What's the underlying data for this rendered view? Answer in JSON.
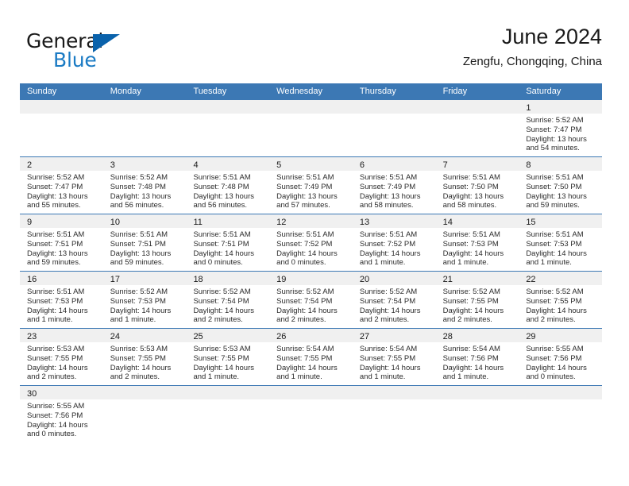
{
  "brand": {
    "name_top": "General",
    "name_bottom": "Blue",
    "accent_color": "#0a62ab",
    "blue_text_color": "#1b7bc4",
    "triangle_icon": "triangle-icon"
  },
  "header": {
    "title": "June 2024",
    "subtitle": "Zengfu, Chongqing, China"
  },
  "calendar": {
    "header_bg": "#3c78b4",
    "row_divider_color": "#3c78b4",
    "day_band_bg": "#f0f0f0",
    "weekdays": [
      "Sunday",
      "Monday",
      "Tuesday",
      "Wednesday",
      "Thursday",
      "Friday",
      "Saturday"
    ],
    "weeks": [
      [
        {
          "day": "",
          "lines": []
        },
        {
          "day": "",
          "lines": []
        },
        {
          "day": "",
          "lines": []
        },
        {
          "day": "",
          "lines": []
        },
        {
          "day": "",
          "lines": []
        },
        {
          "day": "",
          "lines": []
        },
        {
          "day": "1",
          "lines": [
            "Sunrise: 5:52 AM",
            "Sunset: 7:47 PM",
            "Daylight: 13 hours",
            "and 54 minutes."
          ]
        }
      ],
      [
        {
          "day": "2",
          "lines": [
            "Sunrise: 5:52 AM",
            "Sunset: 7:47 PM",
            "Daylight: 13 hours",
            "and 55 minutes."
          ]
        },
        {
          "day": "3",
          "lines": [
            "Sunrise: 5:52 AM",
            "Sunset: 7:48 PM",
            "Daylight: 13 hours",
            "and 56 minutes."
          ]
        },
        {
          "day": "4",
          "lines": [
            "Sunrise: 5:51 AM",
            "Sunset: 7:48 PM",
            "Daylight: 13 hours",
            "and 56 minutes."
          ]
        },
        {
          "day": "5",
          "lines": [
            "Sunrise: 5:51 AM",
            "Sunset: 7:49 PM",
            "Daylight: 13 hours",
            "and 57 minutes."
          ]
        },
        {
          "day": "6",
          "lines": [
            "Sunrise: 5:51 AM",
            "Sunset: 7:49 PM",
            "Daylight: 13 hours",
            "and 58 minutes."
          ]
        },
        {
          "day": "7",
          "lines": [
            "Sunrise: 5:51 AM",
            "Sunset: 7:50 PM",
            "Daylight: 13 hours",
            "and 58 minutes."
          ]
        },
        {
          "day": "8",
          "lines": [
            "Sunrise: 5:51 AM",
            "Sunset: 7:50 PM",
            "Daylight: 13 hours",
            "and 59 minutes."
          ]
        }
      ],
      [
        {
          "day": "9",
          "lines": [
            "Sunrise: 5:51 AM",
            "Sunset: 7:51 PM",
            "Daylight: 13 hours",
            "and 59 minutes."
          ]
        },
        {
          "day": "10",
          "lines": [
            "Sunrise: 5:51 AM",
            "Sunset: 7:51 PM",
            "Daylight: 13 hours",
            "and 59 minutes."
          ]
        },
        {
          "day": "11",
          "lines": [
            "Sunrise: 5:51 AM",
            "Sunset: 7:51 PM",
            "Daylight: 14 hours",
            "and 0 minutes."
          ]
        },
        {
          "day": "12",
          "lines": [
            "Sunrise: 5:51 AM",
            "Sunset: 7:52 PM",
            "Daylight: 14 hours",
            "and 0 minutes."
          ]
        },
        {
          "day": "13",
          "lines": [
            "Sunrise: 5:51 AM",
            "Sunset: 7:52 PM",
            "Daylight: 14 hours",
            "and 1 minute."
          ]
        },
        {
          "day": "14",
          "lines": [
            "Sunrise: 5:51 AM",
            "Sunset: 7:53 PM",
            "Daylight: 14 hours",
            "and 1 minute."
          ]
        },
        {
          "day": "15",
          "lines": [
            "Sunrise: 5:51 AM",
            "Sunset: 7:53 PM",
            "Daylight: 14 hours",
            "and 1 minute."
          ]
        }
      ],
      [
        {
          "day": "16",
          "lines": [
            "Sunrise: 5:51 AM",
            "Sunset: 7:53 PM",
            "Daylight: 14 hours",
            "and 1 minute."
          ]
        },
        {
          "day": "17",
          "lines": [
            "Sunrise: 5:52 AM",
            "Sunset: 7:53 PM",
            "Daylight: 14 hours",
            "and 1 minute."
          ]
        },
        {
          "day": "18",
          "lines": [
            "Sunrise: 5:52 AM",
            "Sunset: 7:54 PM",
            "Daylight: 14 hours",
            "and 2 minutes."
          ]
        },
        {
          "day": "19",
          "lines": [
            "Sunrise: 5:52 AM",
            "Sunset: 7:54 PM",
            "Daylight: 14 hours",
            "and 2 minutes."
          ]
        },
        {
          "day": "20",
          "lines": [
            "Sunrise: 5:52 AM",
            "Sunset: 7:54 PM",
            "Daylight: 14 hours",
            "and 2 minutes."
          ]
        },
        {
          "day": "21",
          "lines": [
            "Sunrise: 5:52 AM",
            "Sunset: 7:55 PM",
            "Daylight: 14 hours",
            "and 2 minutes."
          ]
        },
        {
          "day": "22",
          "lines": [
            "Sunrise: 5:52 AM",
            "Sunset: 7:55 PM",
            "Daylight: 14 hours",
            "and 2 minutes."
          ]
        }
      ],
      [
        {
          "day": "23",
          "lines": [
            "Sunrise: 5:53 AM",
            "Sunset: 7:55 PM",
            "Daylight: 14 hours",
            "and 2 minutes."
          ]
        },
        {
          "day": "24",
          "lines": [
            "Sunrise: 5:53 AM",
            "Sunset: 7:55 PM",
            "Daylight: 14 hours",
            "and 2 minutes."
          ]
        },
        {
          "day": "25",
          "lines": [
            "Sunrise: 5:53 AM",
            "Sunset: 7:55 PM",
            "Daylight: 14 hours",
            "and 1 minute."
          ]
        },
        {
          "day": "26",
          "lines": [
            "Sunrise: 5:54 AM",
            "Sunset: 7:55 PM",
            "Daylight: 14 hours",
            "and 1 minute."
          ]
        },
        {
          "day": "27",
          "lines": [
            "Sunrise: 5:54 AM",
            "Sunset: 7:55 PM",
            "Daylight: 14 hours",
            "and 1 minute."
          ]
        },
        {
          "day": "28",
          "lines": [
            "Sunrise: 5:54 AM",
            "Sunset: 7:56 PM",
            "Daylight: 14 hours",
            "and 1 minute."
          ]
        },
        {
          "day": "29",
          "lines": [
            "Sunrise: 5:55 AM",
            "Sunset: 7:56 PM",
            "Daylight: 14 hours",
            "and 0 minutes."
          ]
        }
      ],
      [
        {
          "day": "30",
          "lines": [
            "Sunrise: 5:55 AM",
            "Sunset: 7:56 PM",
            "Daylight: 14 hours",
            "and 0 minutes."
          ]
        },
        {
          "day": "",
          "lines": []
        },
        {
          "day": "",
          "lines": []
        },
        {
          "day": "",
          "lines": []
        },
        {
          "day": "",
          "lines": []
        },
        {
          "day": "",
          "lines": []
        },
        {
          "day": "",
          "lines": []
        }
      ]
    ]
  }
}
